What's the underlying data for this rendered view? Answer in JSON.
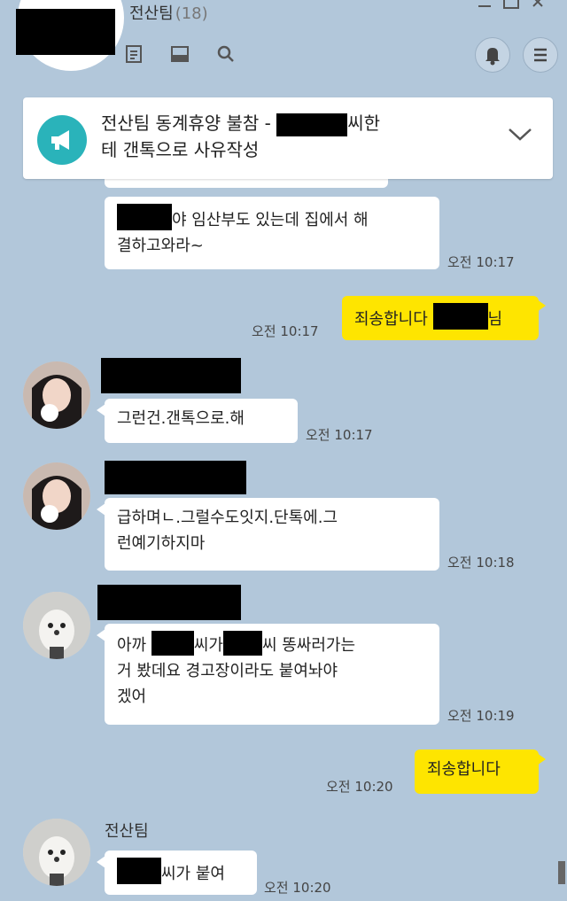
{
  "header": {
    "title": "전산팀",
    "count": "(18)",
    "icons": [
      "note-icon",
      "inbox-icon",
      "search-icon",
      "bell-icon",
      "menu-icon"
    ]
  },
  "notice": {
    "text_part1": "전산팀 동계휴양 불참 - ",
    "text_part2": "씨한",
    "text_line2": "테 갠톡으로 사유작성"
  },
  "messages": {
    "m1": {
      "prefix": "",
      "text_a": "야 임산부도 있는데 집에서 해",
      "text_b": "결하고와라~",
      "time": "오전 10:17"
    },
    "m2": {
      "text": "죄송합니다 ",
      "suffix": "님",
      "time": "오전 10:17"
    },
    "m3": {
      "text": "그런건.갠톡으로.해",
      "time": "오전 10:17"
    },
    "m4": {
      "text_a": "급하며ㄴ.그럴수도잇지.단톡에.그",
      "text_b": "런예기하지마",
      "time": "오전 10:18"
    },
    "m5": {
      "text_a1": "아까 ",
      "text_a2": "씨가",
      "text_a3": "씨 똥싸러가는",
      "text_b": "거 봤데요 경고장이라도 붙여놔야",
      "text_c": "겠어",
      "time": "오전 10:19"
    },
    "m6": {
      "text": "죄송합니다",
      "time": "오전 10:20"
    },
    "m7": {
      "sender": "전산팀",
      "text": "씨가 붙여",
      "time": "오전 10:20"
    }
  },
  "colors": {
    "background": "#b2c7da",
    "my_bubble": "#fee500",
    "other_bubble": "#ffffff",
    "notice_icon": "#2ab3ba"
  }
}
